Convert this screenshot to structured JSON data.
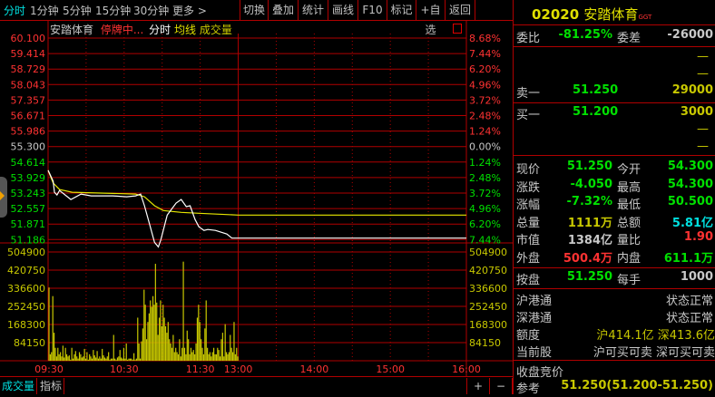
{
  "toolbar": {
    "periods": [
      "分时",
      "1分钟",
      "5分钟",
      "15分钟",
      "30分钟",
      "更多 >"
    ],
    "buttons": [
      "切换",
      "叠加",
      "统计",
      "画线",
      "F10",
      "标记",
      "+自选",
      "返回"
    ]
  },
  "chart_header": {
    "name": "安踏体育",
    "status": "停牌中...",
    "mode": "分时",
    "avg_label": "均线",
    "vol_label": "成交量"
  },
  "bottom_tabs": [
    "成交量",
    "指标"
  ],
  "zoom_buttons": [
    "+",
    "−"
  ],
  "colors": {
    "grid": "#b00000",
    "price": "#ffffff",
    "avg": "#e6e600",
    "volume": "#c8c800",
    "up": "#ff3232",
    "down": "#00e000"
  },
  "chart_data": {
    "type": "line",
    "prev_close": 55.3,
    "price_labels": [
      "60.100",
      "59.414",
      "58.729",
      "58.043",
      "57.357",
      "56.671",
      "55.986",
      "55.300",
      "54.614",
      "53.929",
      "53.243",
      "52.557",
      "51.871",
      "51.186"
    ],
    "pct_labels": [
      "8.68%",
      "7.44%",
      "6.20%",
      "4.96%",
      "3.72%",
      "2.48%",
      "1.24%",
      "0.00%",
      "1.24%",
      "2.48%",
      "3.72%",
      "4.96%",
      "6.20%",
      "7.44%"
    ],
    "volume_labels": [
      "504900",
      "420750",
      "336600",
      "252450",
      "168300",
      "84150"
    ],
    "volume_max": 504900,
    "time_labels": [
      "09:30",
      "10:30",
      "11:30",
      "13:00",
      "14:00",
      "15:00",
      "16:00"
    ],
    "time_minutes": [
      0,
      60,
      120,
      150,
      210,
      270,
      330
    ],
    "total_minutes": 330,
    "price": [
      [
        0,
        54.25
      ],
      [
        4,
        53.77
      ],
      [
        5,
        53.28
      ],
      [
        7,
        53.16
      ],
      [
        9,
        53.36
      ],
      [
        18,
        52.96
      ],
      [
        26,
        53.2
      ],
      [
        34,
        53.12
      ],
      [
        41,
        53.12
      ],
      [
        51,
        53.12
      ],
      [
        62,
        53.08
      ],
      [
        69,
        53.12
      ],
      [
        73,
        53.2
      ],
      [
        76,
        52.68
      ],
      [
        80,
        51.87
      ],
      [
        84,
        51.06
      ],
      [
        87,
        50.86
      ],
      [
        89,
        51.18
      ],
      [
        94,
        52.27
      ],
      [
        101,
        52.8
      ],
      [
        105,
        52.96
      ],
      [
        109,
        52.64
      ],
      [
        112,
        52.68
      ],
      [
        116,
        52.07
      ],
      [
        119,
        51.75
      ],
      [
        123,
        51.59
      ],
      [
        126,
        51.63
      ],
      [
        132,
        51.59
      ],
      [
        141,
        51.43
      ],
      [
        145,
        51.25
      ],
      [
        150,
        51.25
      ],
      [
        330,
        51.25
      ]
    ],
    "avg": [
      [
        0,
        54.25
      ],
      [
        4,
        53.69
      ],
      [
        9,
        53.4
      ],
      [
        19,
        53.28
      ],
      [
        69,
        53.2
      ],
      [
        76,
        53.08
      ],
      [
        84,
        52.68
      ],
      [
        91,
        52.47
      ],
      [
        105,
        52.39
      ],
      [
        119,
        52.35
      ],
      [
        150,
        52.27
      ],
      [
        330,
        52.27
      ]
    ],
    "volume": [
      340000,
      30000,
      40000,
      300000,
      130000,
      60000,
      20000,
      60000,
      30000,
      40000,
      20000,
      70000,
      15000,
      60000,
      30000,
      20000,
      25000,
      5000,
      60000,
      10000,
      30000,
      45000,
      20000,
      10000,
      40000,
      30000,
      15000,
      20000,
      55000,
      10000,
      40000,
      5000,
      30000,
      20000,
      10000,
      50000,
      25000,
      15000,
      45000,
      10000,
      20000,
      10000,
      55000,
      25000,
      15000,
      10000,
      20000,
      40000,
      5000,
      10000,
      10000,
      120000,
      10000,
      5000,
      15000,
      20000,
      50000,
      15000,
      10000,
      60000,
      10000,
      80000,
      5000,
      10000,
      10000,
      10000,
      5000,
      35000,
      5000,
      10000,
      200000,
      80000,
      10000,
      90000,
      150000,
      330000,
      260000,
      100000,
      180000,
      220000,
      280000,
      250000,
      300000,
      260000,
      450000,
      270000,
      120000,
      200000,
      280000,
      160000,
      260000,
      200000,
      160000,
      130000,
      180000,
      100000,
      80000,
      60000,
      120000,
      40000,
      60000,
      40000,
      30000,
      100000,
      20000,
      60000,
      460000,
      60000,
      30000,
      140000,
      100000,
      30000,
      60000,
      40000,
      50000,
      30000,
      80000,
      200000,
      260000,
      180000,
      100000,
      60000,
      30000,
      150000,
      280000,
      60000,
      30000,
      40000,
      20000,
      40000,
      60000,
      30000,
      30000,
      60000,
      50000,
      20000,
      100000,
      130000,
      20000,
      170000,
      40000,
      30000,
      40000,
      120000,
      60000,
      40000,
      180000,
      30000,
      60000,
      20000
    ]
  },
  "quote": {
    "code": "02020",
    "name": "安踏体育",
    "tag": "GGT",
    "weibi_label": "委比",
    "weibi": "-81.25%",
    "weicha_label": "委差",
    "weicha": "-26000",
    "dash": "—",
    "sell1_label": "卖一",
    "sell1_price": "51.250",
    "sell1_vol": "29000",
    "buy1_label": "买一",
    "buy1_price": "51.200",
    "buy1_vol": "3000",
    "stats": [
      {
        "l1": "现价",
        "v1": "51.250",
        "l2": "今开",
        "v2": "54.300"
      },
      {
        "l1": "涨跌",
        "v1": "-4.050",
        "l2": "最高",
        "v2": "54.300"
      },
      {
        "l1": "涨幅",
        "v1": "-7.32%",
        "l2": "最低",
        "v2": "50.500"
      },
      {
        "l1": "总量",
        "v1": "1111万",
        "l2": "总额",
        "v2": "5.81亿"
      },
      {
        "l1": "市值",
        "v1": "1384亿",
        "l2": "量比",
        "v2": "1.90"
      },
      {
        "l1": "外盘",
        "v1": "500.4万",
        "l2": "内盘",
        "v2": "611.1万"
      }
    ],
    "anpan_label": "按盘",
    "anpan": "51.250",
    "meishou_label": "每手",
    "meishou": "1000",
    "hgt_label": "沪港通",
    "hgt": "状态正常",
    "sgt_label": "深港通",
    "sgt": "状态正常",
    "edu_label": "额度",
    "edu": "沪414.1亿 深413.6亿",
    "cur_label": "当前股",
    "cur": "沪可买可卖 深可买可卖",
    "auction_label": "收盘竞价",
    "ref_label": "参考",
    "ref": "51.250(51.200-51.250)"
  }
}
